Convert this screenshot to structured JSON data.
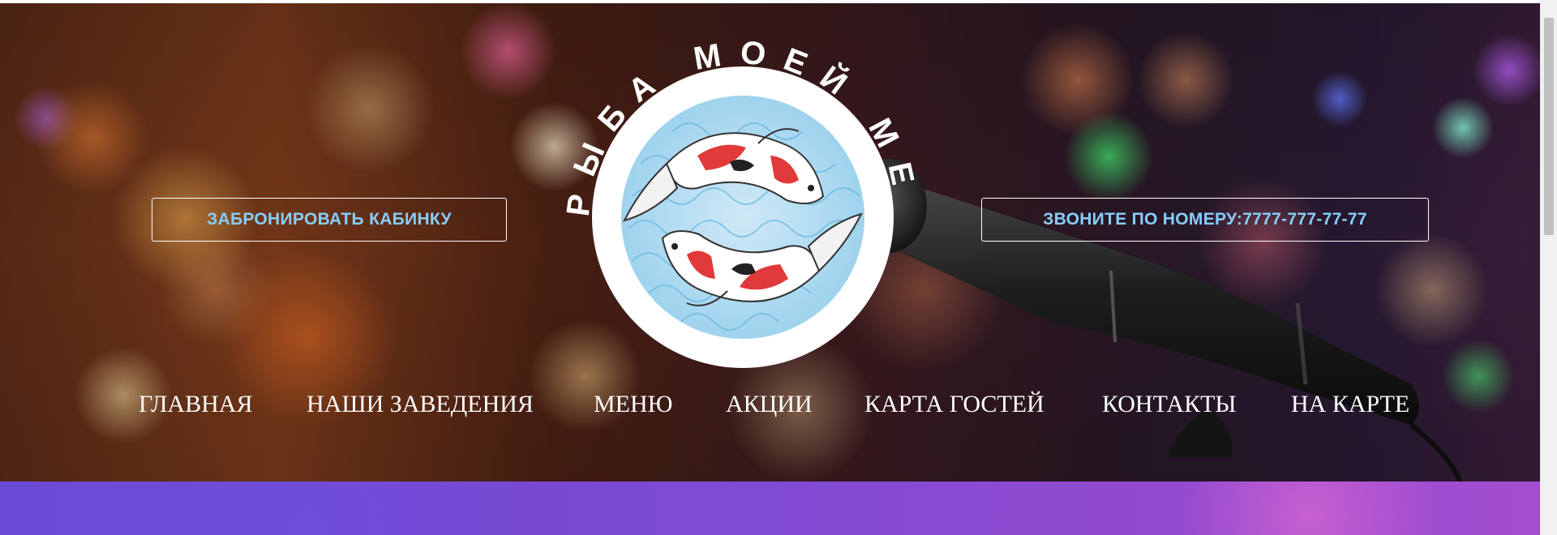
{
  "hero": {
    "book_button": "ЗАБРОНИРОВАТЬ КАБИНКУ",
    "call_button": "ЗВОНИТЕ ПО НОМЕРУ:7777-777-77-77"
  },
  "logo": {
    "ring_text": "РЫБА МОЕЙ МЕЧТЫ"
  },
  "nav": {
    "items": [
      {
        "label": "ГЛАВНАЯ"
      },
      {
        "label": "НАШИ ЗАВЕДЕНИЯ"
      },
      {
        "label": "МЕНЮ"
      },
      {
        "label": "АКЦИИ"
      },
      {
        "label": "КАРТА ГОСТЕЙ"
      },
      {
        "label": "КОНТАКТЫ"
      },
      {
        "label": "НА КАРТЕ"
      }
    ]
  },
  "colors": {
    "button_text": "#87cefa",
    "nav_text": "#ffffff",
    "strip": "#7a4ad4"
  }
}
